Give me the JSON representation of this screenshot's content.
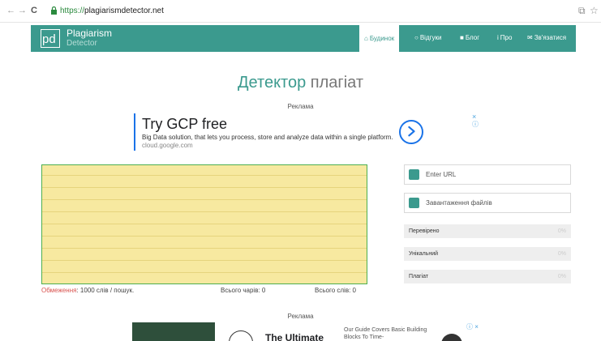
{
  "browser": {
    "back_glyph": "←",
    "forward_glyph": "→",
    "reload_glyph": "C",
    "url_scheme": "https://",
    "url_host": "plagiarismdetector.net",
    "translate_glyph": "⧉",
    "star_glyph": "☆"
  },
  "header": {
    "logo_name": "Plagiarism",
    "logo_sub": "Detector",
    "nav": [
      {
        "label": "Будинок",
        "icon": "home-icon",
        "glyph": "⌂"
      },
      {
        "label": "Відгуки",
        "icon": "comment-icon",
        "glyph": "○"
      },
      {
        "label": "Блог",
        "icon": "briefcase-icon",
        "glyph": "■"
      },
      {
        "label": "Про",
        "icon": "info-icon",
        "glyph": "i"
      },
      {
        "label": "Зв'язатися",
        "icon": "envelope-icon",
        "glyph": "✉"
      }
    ]
  },
  "title": {
    "highlight": "Детектор",
    "rest": "плагіат"
  },
  "ad_top": {
    "label": "Реклама",
    "headline": "Try GCP free",
    "description": "Big Data solution, that lets you process, store and analyze data within a single platform.",
    "domain": "cloud.google.com",
    "close_glyph": "×",
    "info_glyph": "ⓘ"
  },
  "counters": {
    "limit_label": "Обмеження",
    "limit_text": ": 1000 слів / пошук.",
    "chars": "Всього чарів: 0",
    "words": "Всього слів: 0"
  },
  "right_panel": {
    "enter_url": "Enter URL",
    "upload_files": "Завантаження файлів",
    "stats": [
      {
        "label": "Перевірено",
        "value": "0%"
      },
      {
        "label": "Унікальний",
        "value": "0%"
      },
      {
        "label": "Плагіат",
        "value": "0%"
      }
    ]
  },
  "ad_bottom": {
    "label": "Реклама",
    "headline": "The Ultimate",
    "description": "Our Guide Covers Basic Building Blocks To Time-",
    "badge": "ⓘ ×"
  },
  "colors": {
    "brand": "#3b9a8e",
    "textarea_bg": "#f7e9a0",
    "ad_accent": "#1a73e8",
    "warning": "#d9534f"
  }
}
